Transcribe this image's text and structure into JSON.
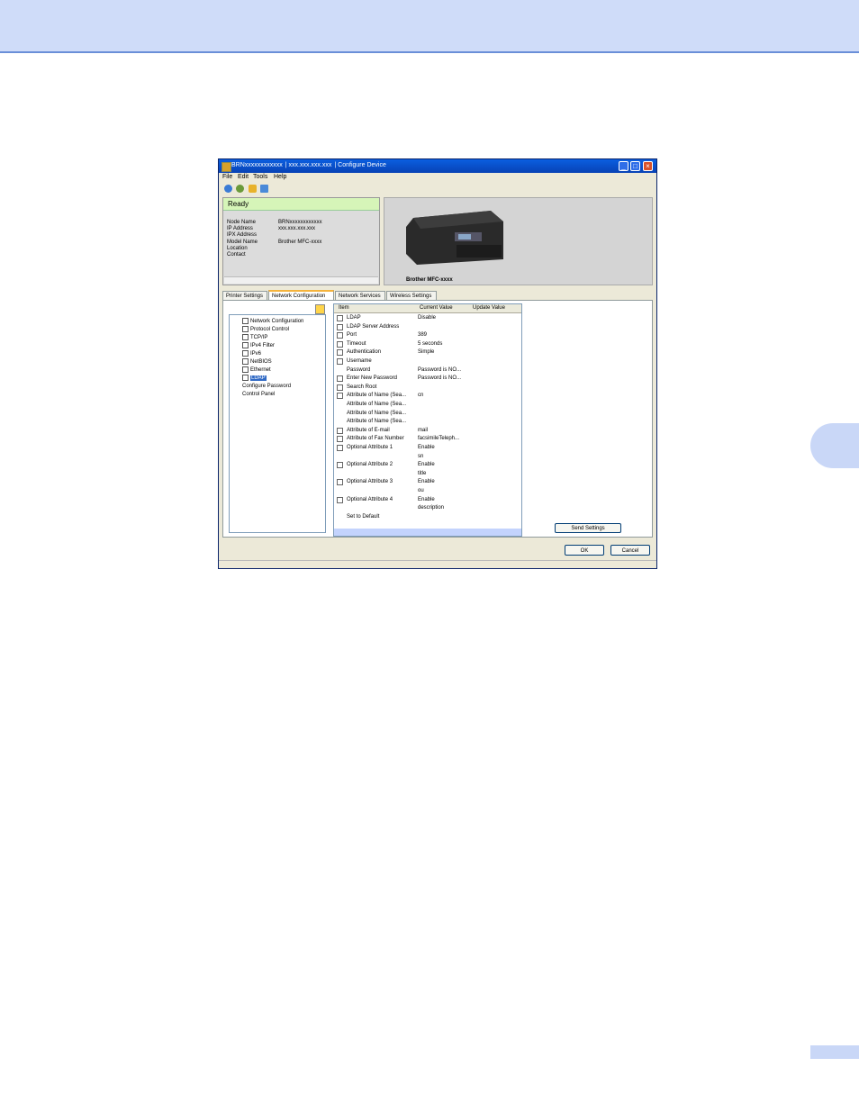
{
  "window": {
    "title_device": "BRNxxxxxxxxxxxx",
    "title_ip": "xxx.xxx.xxx.xxx",
    "title_app": "Configure Device"
  },
  "menu": [
    "File",
    "Edit",
    "Tools",
    "Help"
  ],
  "status": {
    "state": "Ready",
    "rows": [
      {
        "label": "Node Name",
        "value": "BRNxxxxxxxxxxxx"
      },
      {
        "label": "IP Address",
        "value": "xxx.xxx.xxx.xxx"
      },
      {
        "label": "IPX Address",
        "value": ""
      },
      {
        "label": "Model Name",
        "value": "Brother MFC-xxxx"
      },
      {
        "label": "Location",
        "value": ""
      },
      {
        "label": "Contact",
        "value": ""
      }
    ]
  },
  "device_caption": "Brother MFC-xxxx",
  "tabs": [
    "Printer Settings",
    "Network Configuration",
    "Network Services",
    "Wireless Settings"
  ],
  "tree": [
    "Network Configuration",
    "Protocol Control",
    "TCP/IP",
    "IPv4 Filter",
    "IPv6",
    "NetBIOS",
    "Ethernet",
    "LDAP",
    "Configure Password",
    "Control Panel"
  ],
  "grid": {
    "headers": [
      "Item",
      "Current Value",
      "Update Value"
    ],
    "rows": [
      {
        "name": "LDAP",
        "value": "Disable"
      },
      {
        "name": "LDAP Server Address",
        "value": ""
      },
      {
        "name": "Port",
        "value": "389"
      },
      {
        "name": "Timeout",
        "value": "5 seconds"
      },
      {
        "name": "Authentication",
        "value": "Simple"
      },
      {
        "name": "Username",
        "value": ""
      },
      {
        "name": "Password",
        "value": "Password is NO..."
      },
      {
        "name": "Enter New Password",
        "value": "Password is NO..."
      },
      {
        "name": "Search Root",
        "value": ""
      },
      {
        "name": "Attribute of Name (Sea...",
        "value": "cn"
      },
      {
        "name": "Attribute of Name (Sea...",
        "value": ""
      },
      {
        "name": "Attribute of Name (Sea...",
        "value": ""
      },
      {
        "name": "Attribute of Name (Sea...",
        "value": ""
      },
      {
        "name": "Attribute of E-mail",
        "value": "mail"
      },
      {
        "name": "Attribute of Fax Number",
        "value": "facsimileTeleph..."
      },
      {
        "name": "Optional Attribute 1",
        "value": "Enable"
      },
      {
        "name": "",
        "value": "sn"
      },
      {
        "name": "Optional Attribute 2",
        "value": "Enable"
      },
      {
        "name": "",
        "value": "title"
      },
      {
        "name": "Optional Attribute 3",
        "value": "Enable"
      },
      {
        "name": "",
        "value": "ou"
      },
      {
        "name": "Optional Attribute 4",
        "value": "Enable"
      },
      {
        "name": "",
        "value": "description"
      },
      {
        "name": "Set to Default",
        "value": ""
      }
    ]
  },
  "buttons": {
    "send": "Send Settings",
    "ok": "OK",
    "cancel": "Cancel"
  }
}
